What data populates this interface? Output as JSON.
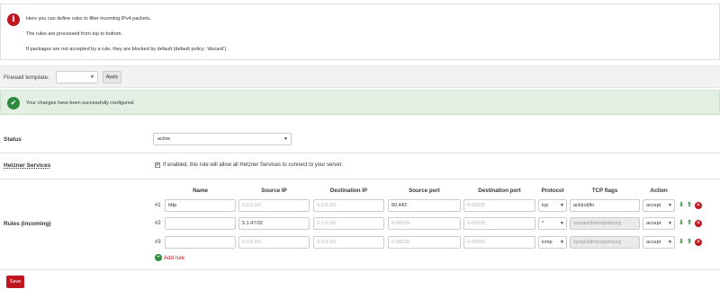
{
  "info": {
    "lines": [
      "Here you can define rules to filter incoming IPv4 packets.",
      "The rules are processed from top to bottom.",
      "If packages are not accepted by a rule, they are blocked by default (default policy: 'discard')."
    ]
  },
  "template": {
    "label": "Firewall template:",
    "value": "",
    "apply_label": "Apply"
  },
  "success": {
    "message": "Your changes have been successfully configured."
  },
  "status": {
    "label": "Status",
    "value": "active"
  },
  "hetzner": {
    "label": "Hetzner Services",
    "checked": true,
    "text": "If enabled, this rule will allow all Hetzner Services to connect to your server."
  },
  "rules": {
    "label": "Rules (incoming)",
    "columns": [
      "Name",
      "Source IP",
      "Destination IP",
      "Source port",
      "Destination port",
      "Protocol",
      "TCP flags",
      "Action"
    ],
    "rows": [
      {
        "num": "#1",
        "name": "http",
        "name_ph": "",
        "source_ip": "",
        "source_ip_ph": "0.0.0.0/0",
        "dest_ip": "",
        "dest_ip_ph": "0.0.0.0/0",
        "source_port": "80,443",
        "source_port_ph": "",
        "dest_port": "",
        "dest_port_ph": "0-65535",
        "protocol": "tcp",
        "tcp_flags": "ack|rst|fin",
        "tcp_flags_disabled": false,
        "action": "accept"
      },
      {
        "num": "#2",
        "name": "",
        "name_ph": "",
        "source_ip": "5.1.47/32",
        "source_ip_ph": "",
        "dest_ip": "",
        "dest_ip_ph": "0.0.0.0/0",
        "source_port": "",
        "source_port_ph": "0-65535",
        "dest_port": "",
        "dest_port_ph": "0-65535",
        "protocol": "*",
        "tcp_flags": "syn|ack|fin|rst|psh|urg",
        "tcp_flags_disabled": true,
        "action": "accept"
      },
      {
        "num": "#3",
        "name": "",
        "name_ph": "",
        "source_ip": "",
        "source_ip_ph": "0.0.0.0/0",
        "dest_ip": "",
        "dest_ip_ph": "0.0.0.0/0",
        "source_port": "",
        "source_port_ph": "0-65535",
        "dest_port": "",
        "dest_port_ph": "0-65535",
        "protocol": "icmp",
        "tcp_flags": "syn|ack|fin|rst|psh|urg",
        "tcp_flags_disabled": true,
        "action": "accept"
      }
    ],
    "add_rule_label": "Add rule"
  },
  "save_label": "Save",
  "colors": {
    "brand_red": "#c0161f",
    "success_green": "#2f8a3e",
    "success_bg": "#e3efe3"
  },
  "icons": {
    "info": "info-icon",
    "success": "checkmark-icon",
    "move_down": "arrow-down-icon",
    "move_up": "arrow-up-icon",
    "delete": "delete-icon",
    "add": "plus-icon"
  }
}
